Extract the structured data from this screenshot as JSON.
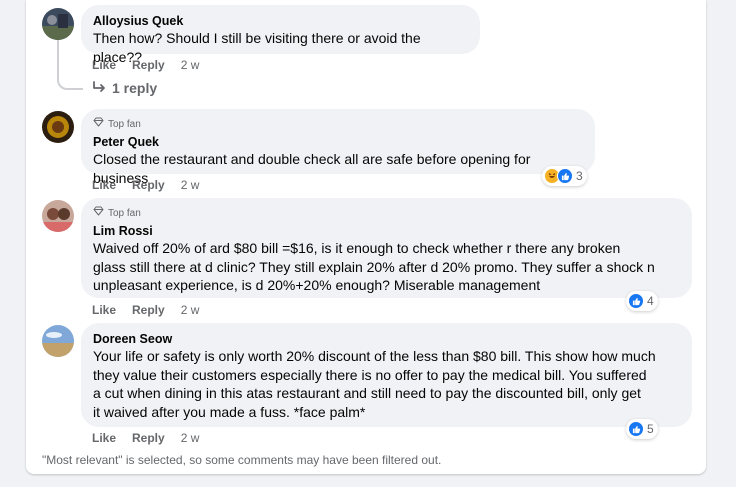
{
  "comments": [
    {
      "name": "Alloysius Quek",
      "badge": "",
      "text_lines": [
        "Then how? Should I still be visiting there or avoid the place??"
      ],
      "like": "Like",
      "reply": "Reply",
      "time": "2 w",
      "replies_label": "1 reply"
    },
    {
      "name": "Peter Quek",
      "badge": "Top fan",
      "text_lines": [
        "Closed the restaurant and double check all are safe before opening for business"
      ],
      "like": "Like",
      "reply": "Reply",
      "time": "2 w",
      "reaction_count": "3"
    },
    {
      "name": "Lim Rossi",
      "badge": "Top fan",
      "text_lines": [
        "Waived off 20% of ard $80 bill =$16, is it enough to check whether r there any broken",
        "glass still there at d clinic? They still explain 20% after d 20% promo. They suffer a shock n",
        "unpleasant experience, is d 20%+20% enough? Miserable management"
      ],
      "like": "Like",
      "reply": "Reply",
      "time": "2 w",
      "reaction_count": "4"
    },
    {
      "name": "Doreen Seow",
      "badge": "",
      "text_lines": [
        "Your life or safety is only worth 20% discount of the less than $80 bill. This show how much",
        "they value their customers especially there is no offer to pay the medical bill. You suffered",
        "a cut when dining in this atas restaurant and still need to pay the discounted bill, only get",
        "it waived after you made a fuss. *face palm*"
      ],
      "like": "Like",
      "reply": "Reply",
      "time": "2 w",
      "reaction_count": "5"
    }
  ],
  "footer": "\"Most relevant\" is selected, so some comments may have been filtered out.",
  "colors": {
    "bubble": "#f0f2f5",
    "secondary_text": "#65676b",
    "like_blue": "#1877f2",
    "haha_yellow": "#f7b125"
  },
  "icons": [
    "reply-arrow-icon",
    "top-fan-diamond-icon",
    "like-reaction-icon",
    "haha-reaction-icon"
  ]
}
